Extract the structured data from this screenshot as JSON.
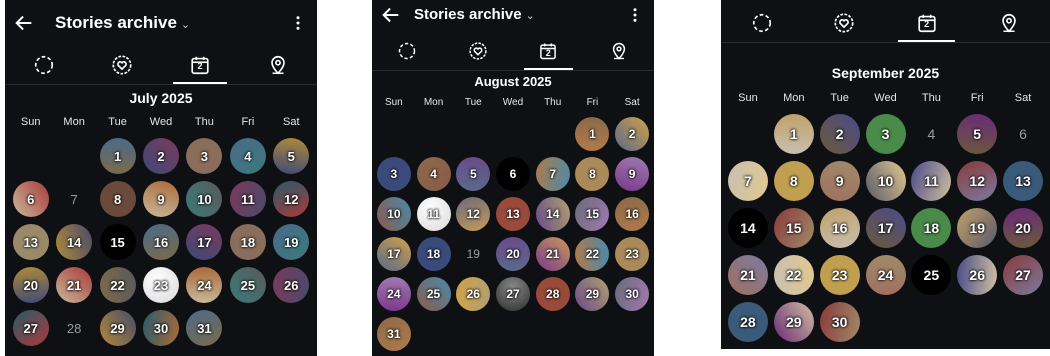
{
  "panels": [
    {
      "key": "july",
      "header": {
        "back_icon": "arrow-left-icon",
        "title": "Stories archive",
        "more_icon": "vertical-dots-icon"
      },
      "tabs": [
        "loading-circle-icon",
        "heart-circle-icon",
        "calendar-icon",
        "location-pin-icon"
      ],
      "active_tab": 2,
      "calendar_icon_number": "2",
      "month_label": "July 2025",
      "weekdays": [
        "Sun",
        "Mon",
        "Tue",
        "Wed",
        "Thu",
        "Fri",
        "Sat"
      ],
      "first_weekday": 2,
      "days": [
        {
          "d": "1",
          "s": "story"
        },
        {
          "d": "2",
          "s": "story"
        },
        {
          "d": "3",
          "s": "story"
        },
        {
          "d": "4",
          "s": "story"
        },
        {
          "d": "5",
          "s": "story"
        },
        {
          "d": "6",
          "s": "story"
        },
        {
          "d": "7",
          "s": "plain"
        },
        {
          "d": "8",
          "s": "story"
        },
        {
          "d": "9",
          "s": "story"
        },
        {
          "d": "10",
          "s": "story"
        },
        {
          "d": "11",
          "s": "story"
        },
        {
          "d": "12",
          "s": "story"
        },
        {
          "d": "13",
          "s": "story"
        },
        {
          "d": "14",
          "s": "story"
        },
        {
          "d": "15",
          "s": "black"
        },
        {
          "d": "16",
          "s": "story"
        },
        {
          "d": "17",
          "s": "story"
        },
        {
          "d": "18",
          "s": "story"
        },
        {
          "d": "19",
          "s": "story"
        },
        {
          "d": "20",
          "s": "story"
        },
        {
          "d": "21",
          "s": "story"
        },
        {
          "d": "22",
          "s": "story"
        },
        {
          "d": "23",
          "s": "white"
        },
        {
          "d": "24",
          "s": "story"
        },
        {
          "d": "25",
          "s": "story"
        },
        {
          "d": "26",
          "s": "story"
        },
        {
          "d": "27",
          "s": "story"
        },
        {
          "d": "28",
          "s": "plain"
        },
        {
          "d": "29",
          "s": "story"
        },
        {
          "d": "30",
          "s": "story"
        },
        {
          "d": "31",
          "s": "story"
        }
      ],
      "ring_colors": [
        "#7b6a4a",
        "#3d4a78",
        "#8a6d5a",
        "#4a6a8a",
        "#b08a3a",
        "#a83a3a",
        "#5a5a5a",
        "#6a4a3a",
        "#c8b89a",
        "#3a7a7a",
        "#7a3a5a",
        "#2a5a6a",
        "#9a8a6a",
        "#4a4a6a",
        "#aa6a3a"
      ]
    },
    {
      "key": "august",
      "header": {
        "back_icon": "arrow-left-icon",
        "title": "Stories archive",
        "more_icon": "vertical-dots-icon"
      },
      "tabs": [
        "loading-circle-icon",
        "heart-circle-icon",
        "calendar-icon",
        "location-pin-icon"
      ],
      "active_tab": 2,
      "calendar_icon_number": "2",
      "month_label": "August 2025",
      "weekdays": [
        "Sun",
        "Mon",
        "Tue",
        "Wed",
        "Thu",
        "Fri",
        "Sat"
      ],
      "first_weekday": 5,
      "days": [
        {
          "d": "1",
          "s": "story"
        },
        {
          "d": "2",
          "s": "story"
        },
        {
          "d": "3",
          "s": "story"
        },
        {
          "d": "4",
          "s": "story"
        },
        {
          "d": "5",
          "s": "story"
        },
        {
          "d": "6",
          "s": "black"
        },
        {
          "d": "7",
          "s": "story"
        },
        {
          "d": "8",
          "s": "story"
        },
        {
          "d": "9",
          "s": "story"
        },
        {
          "d": "10",
          "s": "story"
        },
        {
          "d": "11",
          "s": "white"
        },
        {
          "d": "12",
          "s": "story"
        },
        {
          "d": "13",
          "s": "story"
        },
        {
          "d": "14",
          "s": "story"
        },
        {
          "d": "15",
          "s": "story"
        },
        {
          "d": "16",
          "s": "story"
        },
        {
          "d": "17",
          "s": "story"
        },
        {
          "d": "18",
          "s": "story"
        },
        {
          "d": "19",
          "s": "plain"
        },
        {
          "d": "20",
          "s": "story"
        },
        {
          "d": "21",
          "s": "story"
        },
        {
          "d": "22",
          "s": "story"
        },
        {
          "d": "23",
          "s": "story"
        },
        {
          "d": "24",
          "s": "story"
        },
        {
          "d": "25",
          "s": "story"
        },
        {
          "d": "26",
          "s": "story"
        },
        {
          "d": "27",
          "s": "gray"
        },
        {
          "d": "28",
          "s": "story"
        },
        {
          "d": "29",
          "s": "story"
        },
        {
          "d": "30",
          "s": "story"
        },
        {
          "d": "31",
          "s": "story"
        }
      ],
      "ring_colors": [
        "#b07a4a",
        "#5a6a8a",
        "#3a4a7a",
        "#8a6a4a",
        "#6a4a8a",
        "#c89a5a",
        "#4a8aaa",
        "#aa8a5a",
        "#7a3a8a",
        "#8a5a4a",
        "#d0a04a",
        "#6a6a7a",
        "#9a4a3a",
        "#b0a070",
        "#a07ab0"
      ]
    },
    {
      "key": "september",
      "header": null,
      "tabs": [
        "loading-circle-icon",
        "heart-circle-icon",
        "calendar-icon",
        "location-pin-icon"
      ],
      "active_tab": 2,
      "calendar_icon_number": "2",
      "month_label": "September 2025",
      "weekdays": [
        "Sun",
        "Mon",
        "Tue",
        "Wed",
        "Thu",
        "Fri",
        "Sat"
      ],
      "first_weekday": 1,
      "days": [
        {
          "d": "1",
          "s": "story"
        },
        {
          "d": "2",
          "s": "story"
        },
        {
          "d": "3",
          "s": "story"
        },
        {
          "d": "4",
          "s": "plain"
        },
        {
          "d": "5",
          "s": "story"
        },
        {
          "d": "6",
          "s": "plain"
        },
        {
          "d": "7",
          "s": "story"
        },
        {
          "d": "8",
          "s": "story"
        },
        {
          "d": "9",
          "s": "story"
        },
        {
          "d": "10",
          "s": "story"
        },
        {
          "d": "11",
          "s": "story"
        },
        {
          "d": "12",
          "s": "story"
        },
        {
          "d": "13",
          "s": "story"
        },
        {
          "d": "14",
          "s": "black"
        },
        {
          "d": "15",
          "s": "story"
        },
        {
          "d": "16",
          "s": "story"
        },
        {
          "d": "17",
          "s": "story"
        },
        {
          "d": "18",
          "s": "story"
        },
        {
          "d": "19",
          "s": "story"
        },
        {
          "d": "20",
          "s": "story"
        },
        {
          "d": "21",
          "s": "story"
        },
        {
          "d": "22",
          "s": "story"
        },
        {
          "d": "23",
          "s": "story"
        },
        {
          "d": "24",
          "s": "story"
        },
        {
          "d": "25",
          "s": "black"
        },
        {
          "d": "26",
          "s": "story"
        },
        {
          "d": "27",
          "s": "story"
        },
        {
          "d": "28",
          "s": "story"
        },
        {
          "d": "29",
          "s": "story"
        },
        {
          "d": "30",
          "s": "story"
        }
      ],
      "ring_colors": [
        "#c8c0b0",
        "#6a5a3a",
        "#4a8a4a",
        "#c0a06a",
        "#6a2a7a",
        "#7a7aa0",
        "#e0c890",
        "#c0a050",
        "#a07060",
        "#5a5a6a",
        "#4a4a8a",
        "#8a3a3a",
        "#3a5a7a",
        "#d0c0a0",
        "#a08a6a"
      ]
    }
  ]
}
